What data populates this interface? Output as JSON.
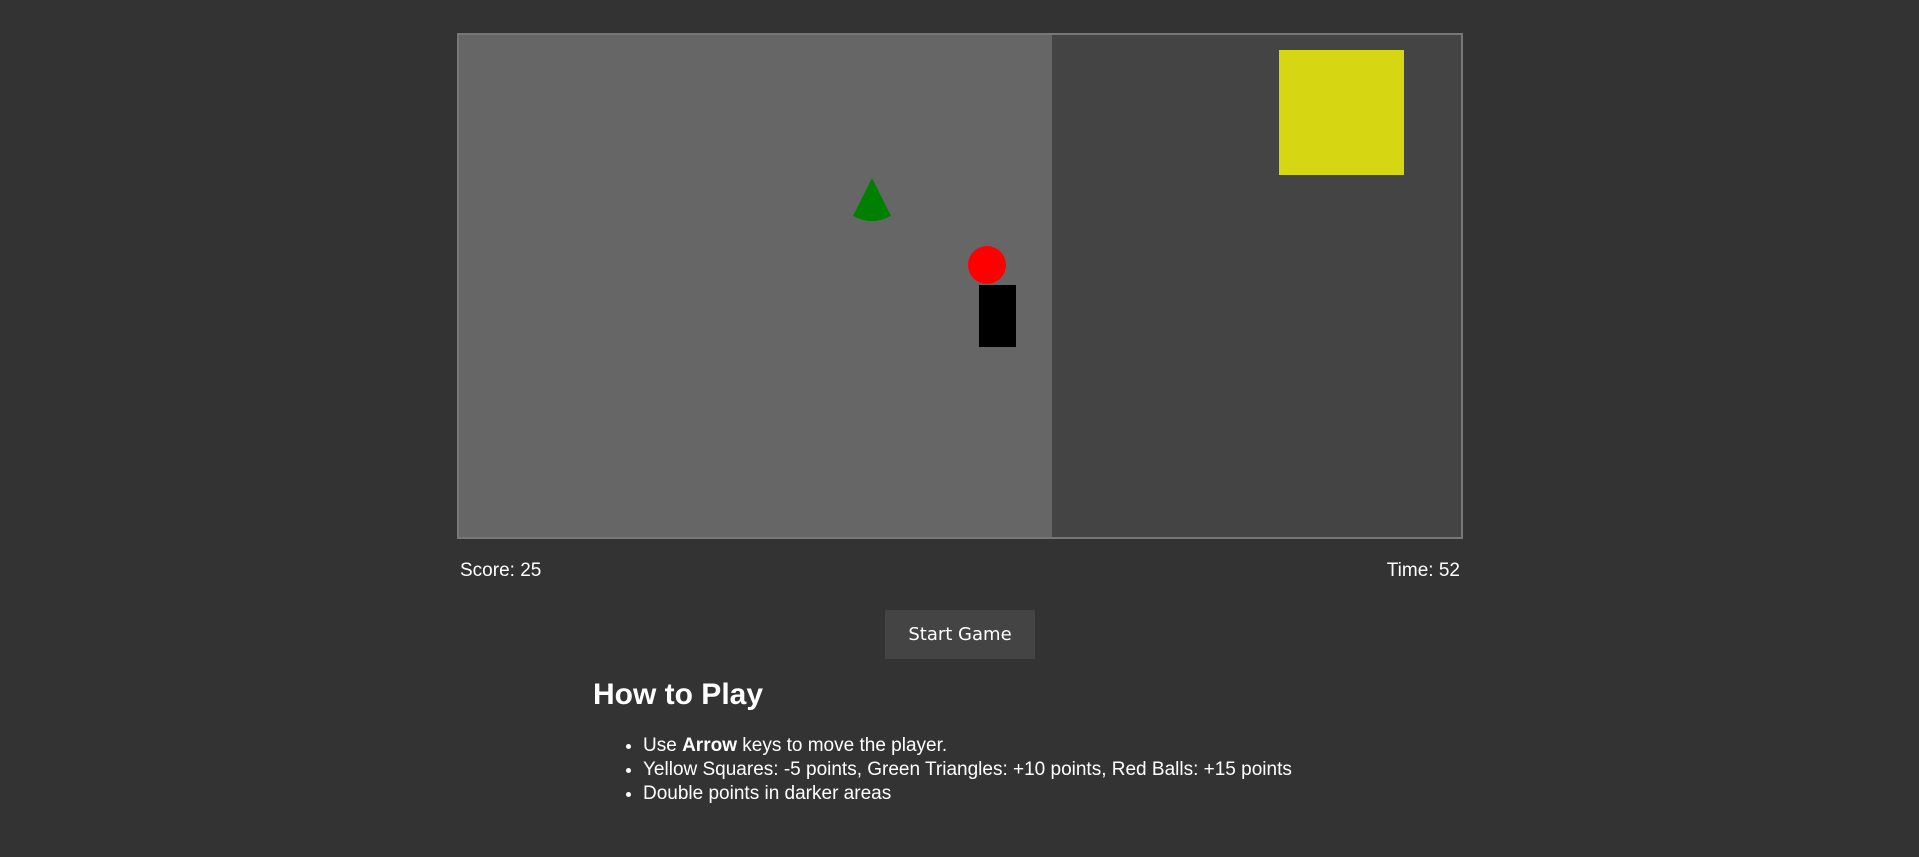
{
  "game": {
    "colors": {
      "board": "#666666",
      "dark_area": "#444444",
      "yellow_square": "#d6d613",
      "green_triangle": "#008000",
      "red_ball": "#ff0000",
      "player": "#000000"
    }
  },
  "hud": {
    "score_text": "Score: 25",
    "time_text": "Time: 52"
  },
  "controls": {
    "start_label": "Start Game"
  },
  "instructions": {
    "title": "How to Play",
    "line1_prefix": "Use ",
    "line1_bold": "Arrow",
    "line1_suffix": " keys to move the player.",
    "line2": "Yellow Squares: -5 points, Green Triangles: +10 points, Red Balls: +15 points",
    "line3": "Double points in darker areas"
  }
}
